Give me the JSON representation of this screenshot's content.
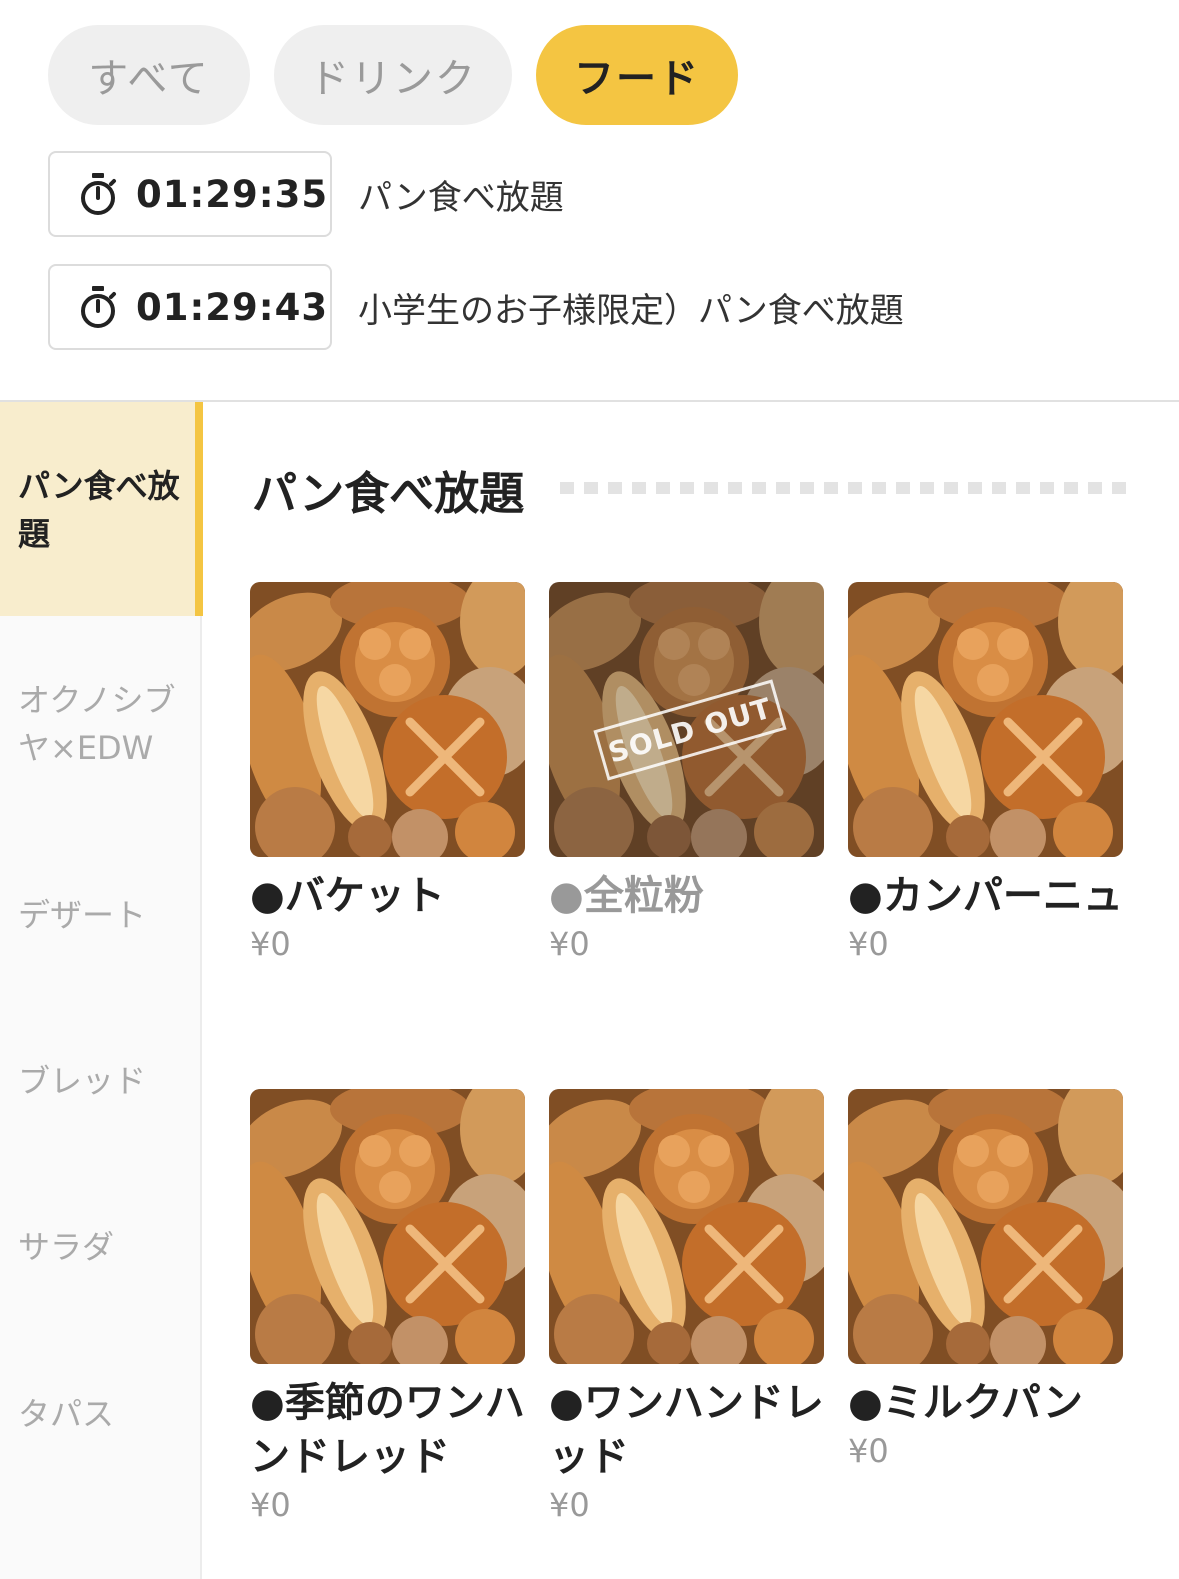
{
  "tabs": [
    {
      "label": "すべて",
      "active": false
    },
    {
      "label": "ドリンク",
      "active": false
    },
    {
      "label": "フード",
      "active": true
    }
  ],
  "timers": [
    {
      "time": "01:29:35",
      "label": "パン食べ放題"
    },
    {
      "time": "01:29:43",
      "label": "小学生のお子様限定）パン食べ放題"
    }
  ],
  "sidebar": {
    "items": [
      {
        "label": "パン食べ放題",
        "active": true
      },
      {
        "label": "オクノシブヤ×EDW",
        "active": false
      },
      {
        "label": "デザート",
        "active": false
      },
      {
        "label": "ブレッド",
        "active": false
      },
      {
        "label": "サラダ",
        "active": false
      },
      {
        "label": "タパス",
        "active": false
      }
    ]
  },
  "section": {
    "title": "パン食べ放題"
  },
  "products": [
    {
      "name": "●バケット",
      "price": "¥0",
      "sold_out": false
    },
    {
      "name": "●全粒粉",
      "price": "¥0",
      "sold_out": true,
      "badge": "SOLD OUT"
    },
    {
      "name": "●カンパーニュ",
      "price": "¥0",
      "sold_out": false
    },
    {
      "name": "●季節のワンハンドレッド",
      "price": "¥0",
      "sold_out": false
    },
    {
      "name": "●ワンハンドレッド",
      "price": "¥0",
      "sold_out": false
    },
    {
      "name": "●ミルクパン",
      "price": "¥0",
      "sold_out": false
    }
  ],
  "colors": {
    "accent": "#f4c542",
    "sidebar_active_bg": "#f8edcd"
  },
  "icons": {
    "timer": "stopwatch-icon"
  }
}
